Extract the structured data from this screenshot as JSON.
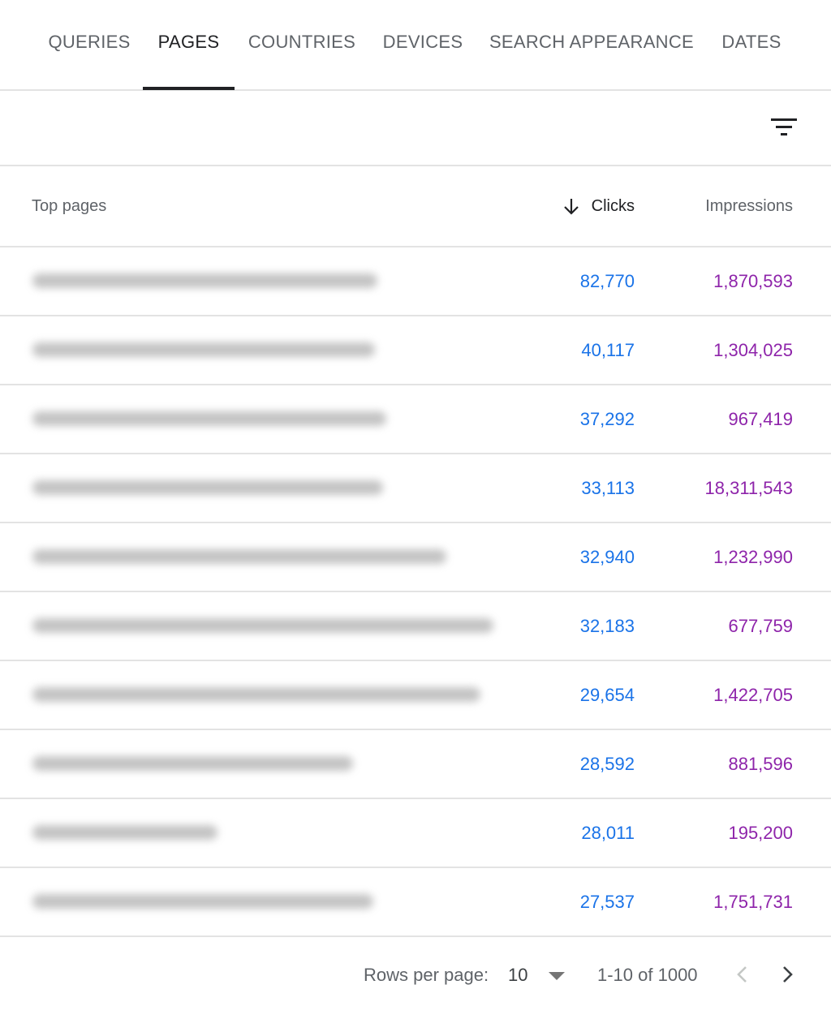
{
  "tabs": [
    {
      "label": "QUERIES",
      "active": false
    },
    {
      "label": "PAGES",
      "active": true
    },
    {
      "label": "COUNTRIES",
      "active": false
    },
    {
      "label": "DEVICES",
      "active": false
    },
    {
      "label": "SEARCH APPEARANCE",
      "active": false
    },
    {
      "label": "DATES",
      "active": false
    }
  ],
  "toolbar": {
    "filter_icon": "filter-list-icon"
  },
  "table": {
    "headers": {
      "page": "Top pages",
      "clicks": "Clicks",
      "impressions": "Impressions"
    },
    "sort": {
      "column": "clicks",
      "direction": "descending",
      "icon": "arrow-down-icon"
    },
    "rows": [
      {
        "clicks": "82,770",
        "impressions": "1,870,593"
      },
      {
        "clicks": "40,117",
        "impressions": "1,304,025"
      },
      {
        "clicks": "37,292",
        "impressions": "967,419"
      },
      {
        "clicks": "33,113",
        "impressions": "18,311,543"
      },
      {
        "clicks": "32,940",
        "impressions": "1,232,990"
      },
      {
        "clicks": "32,183",
        "impressions": "677,759"
      },
      {
        "clicks": "29,654",
        "impressions": "1,422,705"
      },
      {
        "clicks": "28,592",
        "impressions": "881,596"
      },
      {
        "clicks": "28,011",
        "impressions": "195,200"
      },
      {
        "clicks": "27,537",
        "impressions": "1,751,731"
      }
    ]
  },
  "pagination": {
    "rows_per_page_label": "Rows per page:",
    "rows_per_page_value": "10",
    "range": "1-10 of 1000",
    "prev_icon": "chevron-left-icon",
    "next_icon": "chevron-right-icon"
  },
  "colors": {
    "clicks": "#1a73e8",
    "impressions": "#8e24aa",
    "active_tab": "#202124",
    "inactive_tab": "#5f6368",
    "divider": "#e3e3e3"
  }
}
